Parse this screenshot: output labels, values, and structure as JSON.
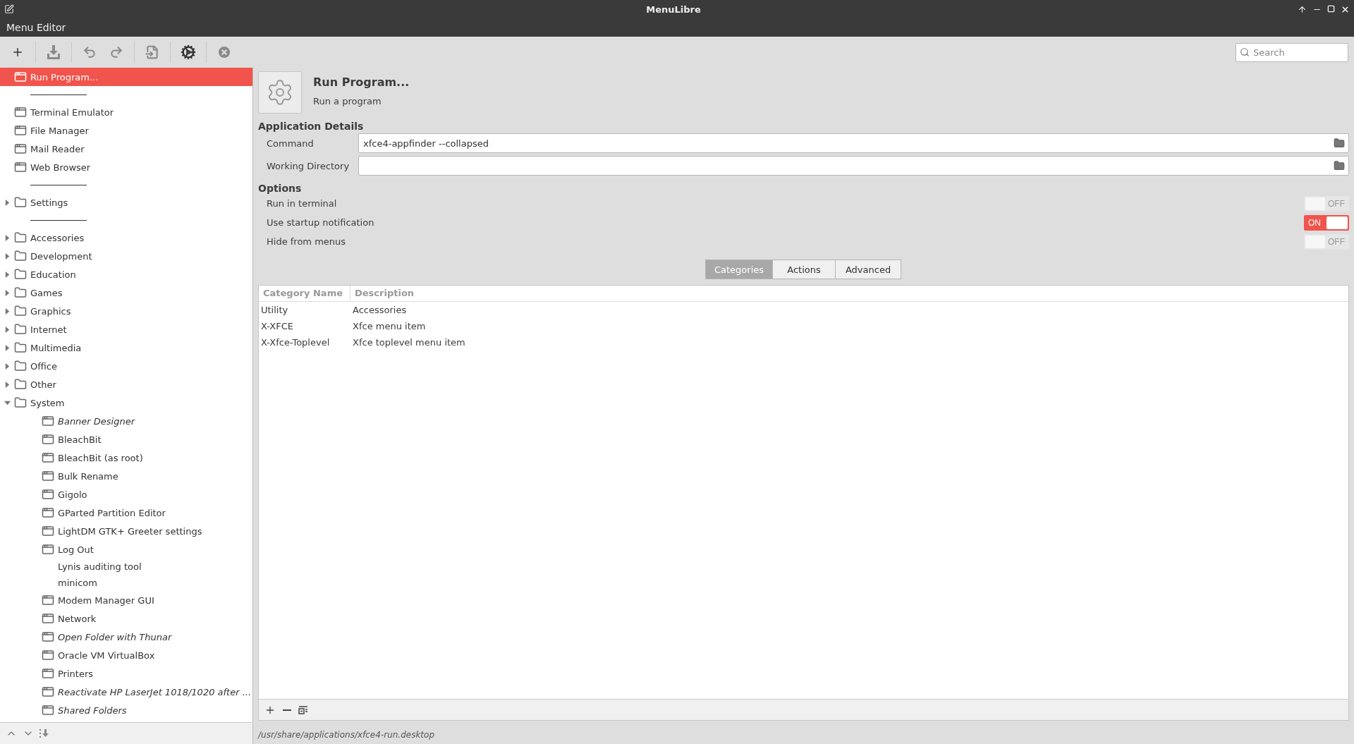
{
  "window": {
    "title": "MenuLibre"
  },
  "menubar": {
    "title": "Menu Editor"
  },
  "search": {
    "placeholder": "Search"
  },
  "tree": [
    {
      "kind": "launcher",
      "label": "Run Program...",
      "selected": true,
      "hidden": false,
      "has_icon": true
    },
    {
      "kind": "separator",
      "selected": false
    },
    {
      "kind": "launcher",
      "label": "Terminal Emulator",
      "selected": false,
      "hidden": false,
      "has_icon": true
    },
    {
      "kind": "launcher",
      "label": "File Manager",
      "selected": false,
      "hidden": false,
      "has_icon": true
    },
    {
      "kind": "launcher",
      "label": "Mail Reader",
      "selected": false,
      "hidden": false,
      "has_icon": true
    },
    {
      "kind": "launcher",
      "label": "Web Browser",
      "selected": false,
      "hidden": false,
      "has_icon": true
    },
    {
      "kind": "separator",
      "selected": false
    },
    {
      "kind": "directory",
      "label": "Settings",
      "selected": false,
      "hidden": false,
      "has_icon": true,
      "expanded": false
    },
    {
      "kind": "separator",
      "selected": false
    },
    {
      "kind": "directory",
      "label": "Accessories",
      "selected": false,
      "hidden": false,
      "has_icon": true,
      "expanded": false
    },
    {
      "kind": "directory",
      "label": "Development",
      "selected": false,
      "hidden": false,
      "has_icon": true,
      "expanded": false
    },
    {
      "kind": "directory",
      "label": "Education",
      "selected": false,
      "hidden": false,
      "has_icon": true,
      "expanded": false
    },
    {
      "kind": "directory",
      "label": "Games",
      "selected": false,
      "hidden": false,
      "has_icon": true,
      "expanded": false
    },
    {
      "kind": "directory",
      "label": "Graphics",
      "selected": false,
      "hidden": false,
      "has_icon": true,
      "expanded": false
    },
    {
      "kind": "directory",
      "label": "Internet",
      "selected": false,
      "hidden": false,
      "has_icon": true,
      "expanded": false
    },
    {
      "kind": "directory",
      "label": "Multimedia",
      "selected": false,
      "hidden": false,
      "has_icon": true,
      "expanded": false
    },
    {
      "kind": "directory",
      "label": "Office",
      "selected": false,
      "hidden": false,
      "has_icon": true,
      "expanded": false
    },
    {
      "kind": "directory",
      "label": "Other",
      "selected": false,
      "hidden": false,
      "has_icon": true,
      "expanded": false
    },
    {
      "kind": "directory",
      "label": "System",
      "selected": false,
      "hidden": false,
      "has_icon": true,
      "expanded": true,
      "children": [
        {
          "kind": "launcher",
          "label": "Banner Designer",
          "selected": false,
          "hidden": true,
          "has_icon": true
        },
        {
          "kind": "launcher",
          "label": "BleachBit",
          "selected": false,
          "hidden": false,
          "has_icon": true
        },
        {
          "kind": "launcher",
          "label": "BleachBit (as root)",
          "selected": false,
          "hidden": false,
          "has_icon": true
        },
        {
          "kind": "launcher",
          "label": "Bulk Rename",
          "selected": false,
          "hidden": false,
          "has_icon": true
        },
        {
          "kind": "launcher",
          "label": "Gigolo",
          "selected": false,
          "hidden": false,
          "has_icon": true
        },
        {
          "kind": "launcher",
          "label": "GParted Partition Editor",
          "selected": false,
          "hidden": false,
          "has_icon": true
        },
        {
          "kind": "launcher",
          "label": "LightDM GTK+ Greeter settings",
          "selected": false,
          "hidden": false,
          "has_icon": true
        },
        {
          "kind": "launcher",
          "label": "Log Out",
          "selected": false,
          "hidden": false,
          "has_icon": true
        },
        {
          "kind": "launcher",
          "label": "Lynis auditing tool",
          "selected": false,
          "hidden": false,
          "has_icon": false
        },
        {
          "kind": "launcher",
          "label": "minicom",
          "selected": false,
          "hidden": false,
          "has_icon": false
        },
        {
          "kind": "launcher",
          "label": "Modem Manager GUI",
          "selected": false,
          "hidden": false,
          "has_icon": true
        },
        {
          "kind": "launcher",
          "label": "Network",
          "selected": false,
          "hidden": false,
          "has_icon": true
        },
        {
          "kind": "launcher",
          "label": "Open Folder with Thunar",
          "selected": false,
          "hidden": true,
          "has_icon": true
        },
        {
          "kind": "launcher",
          "label": "Oracle VM VirtualBox",
          "selected": false,
          "hidden": false,
          "has_icon": true
        },
        {
          "kind": "launcher",
          "label": "Printers",
          "selected": false,
          "hidden": false,
          "has_icon": true
        },
        {
          "kind": "launcher",
          "label": "Reactivate HP LaserJet 1018/1020 after ...",
          "selected": false,
          "hidden": true,
          "has_icon": true
        },
        {
          "kind": "launcher",
          "label": "Shared Folders",
          "selected": false,
          "hidden": true,
          "has_icon": true
        }
      ]
    }
  ],
  "details": {
    "name": "Run Program...",
    "comment": "Run a program"
  },
  "application_details": {
    "heading": "Application Details",
    "fields": [
      {
        "label": "Command",
        "value": "xfce4-appfinder --collapsed"
      },
      {
        "label": "Working Directory"
      }
    ]
  },
  "options": {
    "heading": "Options",
    "items": [
      {
        "label": "Run in terminal",
        "on": false,
        "switch_text": "OFF"
      },
      {
        "label": "Use startup notification",
        "on": true,
        "switch_text": "ON"
      },
      {
        "label": "Hide from menus",
        "on": false,
        "switch_text": "OFF"
      }
    ]
  },
  "tabs": [
    {
      "label": "Categories",
      "selected": true
    },
    {
      "label": "Actions",
      "selected": false
    },
    {
      "label": "Advanced",
      "selected": false
    }
  ],
  "table": {
    "columns": [
      "Category Name",
      "Description"
    ],
    "rows": [
      [
        "Utility",
        "Accessories"
      ],
      [
        "X-XFCE",
        "Xfce menu item"
      ],
      [
        "X-Xfce-Toplevel",
        "Xfce toplevel menu item"
      ]
    ]
  },
  "status_bar": "/usr/share/applications/xfce4-run.desktop"
}
